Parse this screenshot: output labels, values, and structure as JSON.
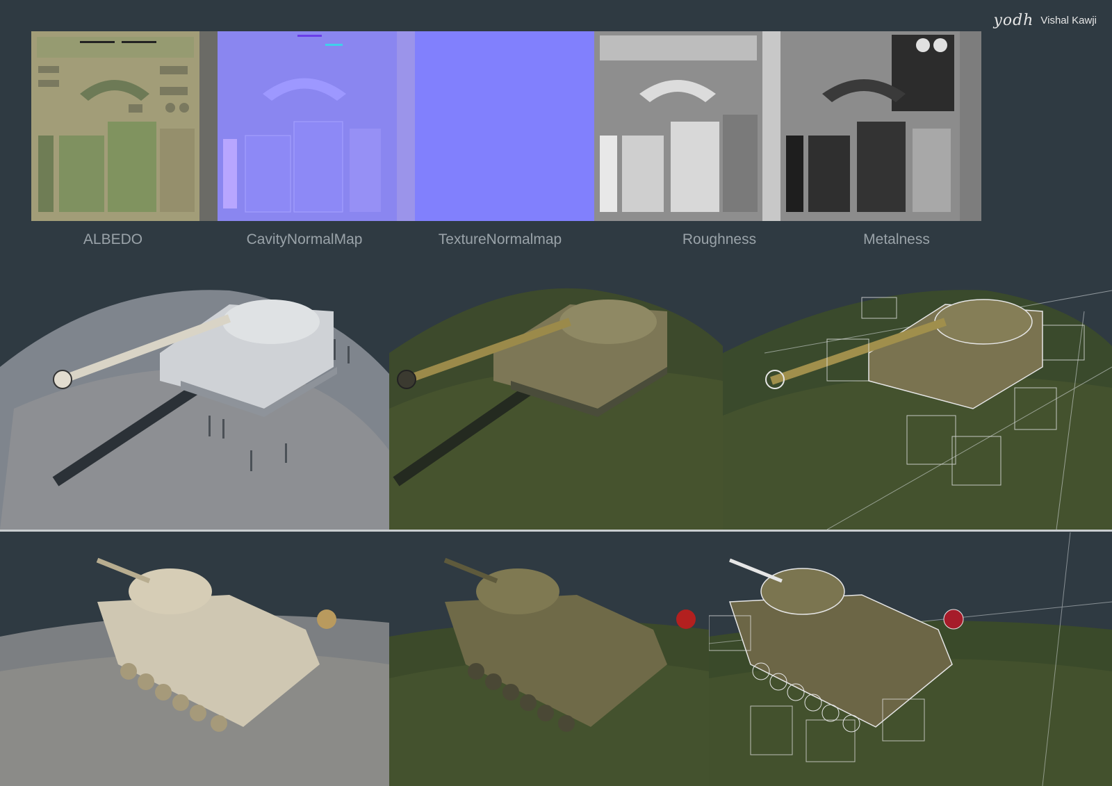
{
  "signature": {
    "logo": "yodh",
    "name": "Vishal Kawji"
  },
  "texture_maps": [
    {
      "label": "ALBEDO",
      "color": "#a29d78"
    },
    {
      "label": "CavityNormalMap",
      "color": "#8a86f0"
    },
    {
      "label": "TextureNormalmap",
      "color": "#8180fd"
    },
    {
      "label": "Roughness",
      "color": "#9a9a9a"
    },
    {
      "label": "Metalness",
      "color": "#8c8c8c"
    }
  ],
  "render_rows": {
    "top": [
      "clay-render",
      "textured-render",
      "wireframe-render"
    ],
    "bottom": [
      "clay-render",
      "textured-render",
      "wireframe-render"
    ]
  },
  "colors": {
    "background": "#2f3a42",
    "divider": "#c9cdd0"
  }
}
